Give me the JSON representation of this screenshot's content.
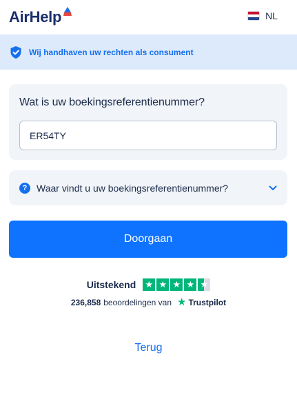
{
  "header": {
    "logo_text": "AirHelp",
    "language": "NL",
    "colors": {
      "logo": "#1b2f6b",
      "logo_mark_top": "#1570ef",
      "logo_mark_bottom": "#e8473c"
    }
  },
  "banner": {
    "icon": "shield-check-icon",
    "text": "Wij handhaven uw rechten als consument",
    "background": "#dceafb",
    "color": "#1570ef"
  },
  "booking_reference": {
    "title": "Wat is uw boekingsreferentienummer?",
    "value": "ER54TY"
  },
  "help": {
    "icon": "question-circle-icon",
    "label": "Waar vindt u uw boekingsreferentienummer?",
    "toggle_icon": "chevron-down-icon"
  },
  "continue_button": {
    "label": "Doorgaan",
    "color": "#0f73ff"
  },
  "trustpilot": {
    "rating_word": "Uitstekend",
    "stars": 4.5,
    "review_count": "236,858",
    "reviews_text": "beoordelingen van",
    "brand": "Trustpilot",
    "color": "#00b67a"
  },
  "back_link": {
    "label": "Terug"
  }
}
